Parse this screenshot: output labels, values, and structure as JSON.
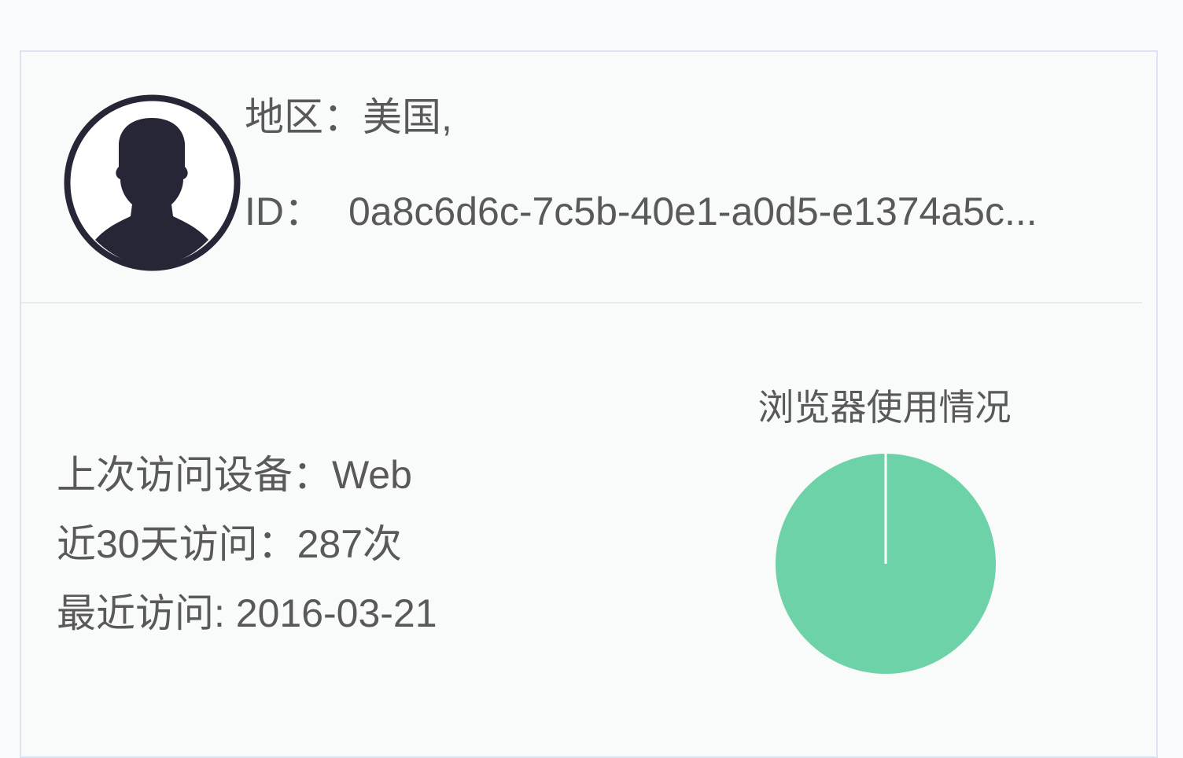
{
  "profile": {
    "region_label": "地区：",
    "region_value": "美国,",
    "id_label": "ID：",
    "id_value": "0a8c6d6c-7c5b-40e1-a0d5-e1374a5c..."
  },
  "stats": {
    "last_device": "上次访问设备：Web",
    "visits_30d": "近30天访问：287次",
    "last_visit": "最近访问: 2016-03-21"
  },
  "icons": {
    "avatar": "user-silhouette-icon"
  },
  "colors": {
    "pie_fill": "#6ed2a9",
    "avatar_dark": "#262637"
  },
  "chart_data": {
    "type": "pie",
    "title": "浏览器使用情况",
    "slices": [
      {
        "value": 100
      }
    ]
  }
}
